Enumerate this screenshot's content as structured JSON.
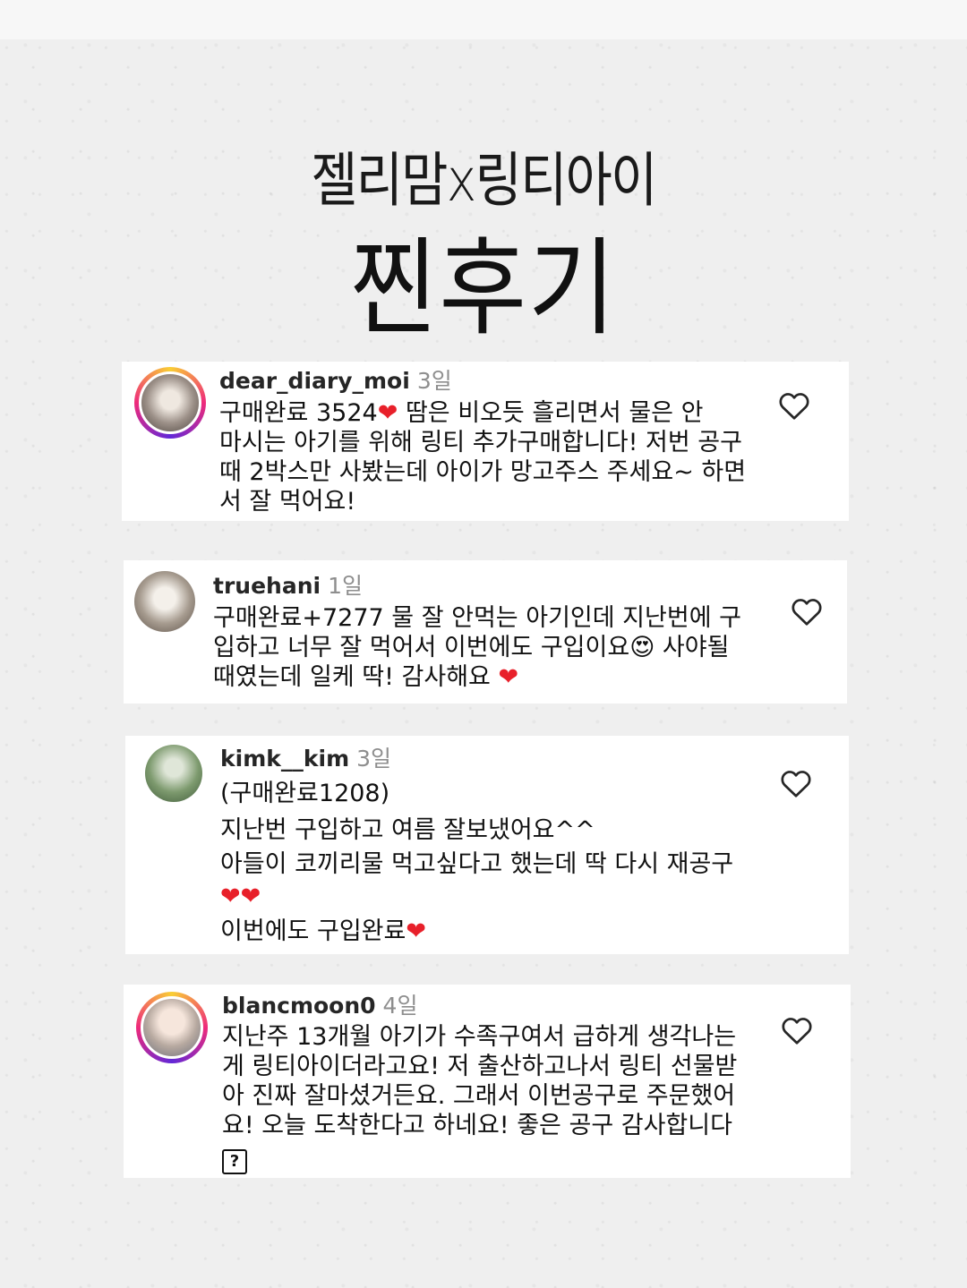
{
  "header": {
    "subtitle": "젤리맘x링티아이",
    "title": "찐후기"
  },
  "comments": [
    {
      "username": "dear_diary_moi",
      "time": "3일",
      "lines": [
        "구매완료 3524❤️ 땀은 비오듯 흘리면서 물은 안",
        "마시는 아기를 위해 링티 추가구매합니다! 저번 공구",
        "때 2박스만 사봤는데 아이가 망고주스 주세요~ 하면",
        "서 잘 먹어요!"
      ]
    },
    {
      "username": "truehani",
      "time": "1일",
      "lines": [
        "구매완료+7277 물 잘 안먹는 아기인데 지난번에 구",
        "입하고 너무 잘 먹어서 이번에도 구입이요😍 사야될",
        "때였는데 일케 딱! 감사해요 ❤️"
      ]
    },
    {
      "username": "kimk__kim",
      "time": "3일",
      "lines": [
        "(구매완료1208)",
        "지난번 구입하고 여름 잘보냈어요^^",
        "아들이 코끼리물 먹고싶다고 했는데 딱 다시 재공구",
        "❤️❤️",
        "이번에도 구입완료❤️"
      ]
    },
    {
      "username": "blancmoon0",
      "time": "4일",
      "lines": [
        "지난주 13개월 아기가 수족구여서 급하게 생각나는",
        "게 링티아이더라고요! 저 출산하고나서 링티 선물받",
        "아 진짜 잘마셨거든요. 그래서 이번공구로 주문했어",
        "요! 오늘 도착한다고 하네요! 좋은 공구 감사합니다"
      ],
      "trailing_symbol": "?"
    }
  ],
  "icons": {
    "like": "heart-outline-icon"
  },
  "colors": {
    "background": "#efefef",
    "card": "#ffffff",
    "username": "#262626",
    "time": "#8e8e8e",
    "heart_emoji": "#e8202a"
  }
}
